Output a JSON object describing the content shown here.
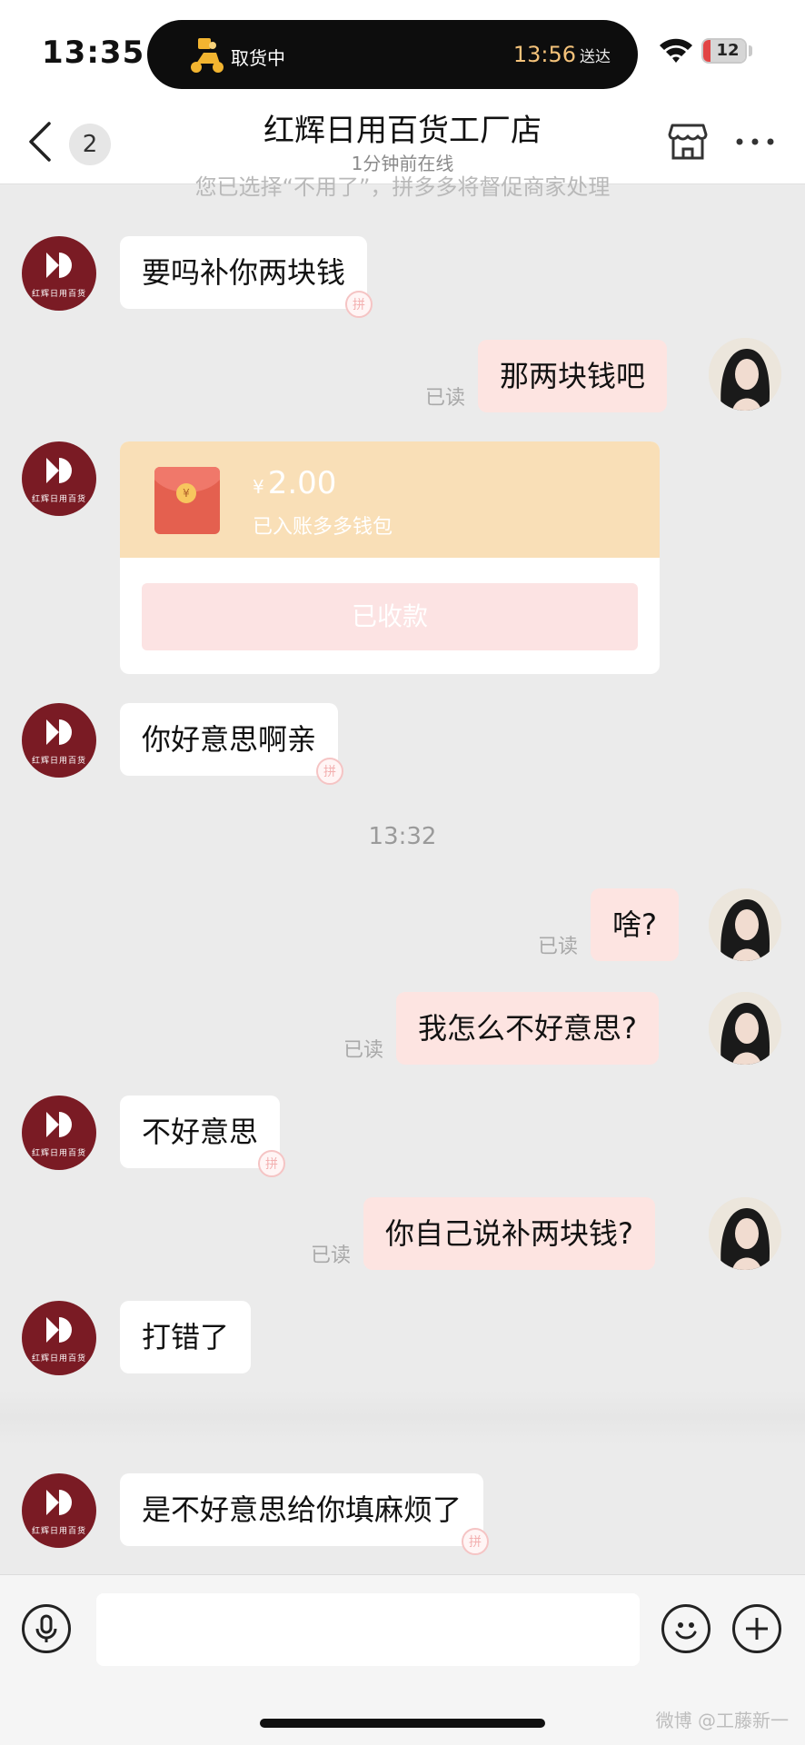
{
  "status_bar": {
    "time": "13:35",
    "delivery_status": "取货中",
    "delivery_eta": "13:56",
    "delivery_eta_suffix": "送达",
    "battery": "12"
  },
  "header": {
    "unread_count": "2",
    "title": "红辉日用百货工厂店",
    "subtitle": "1分钟前在线"
  },
  "chat": {
    "faded_notice": "您已选择“不用了”，拼多多将督促商家处理",
    "shop_avatar_text": "红辉日用百货",
    "read_label": "已读",
    "timestamp": "13:32",
    "messages": [
      {
        "from": "shop",
        "text": "要吗补你两块钱"
      },
      {
        "from": "me",
        "text": "那两块钱吧"
      },
      {
        "from": "shop",
        "type": "red_packet",
        "currency": "¥",
        "amount": "2.00",
        "status_text": "已入账多多钱包",
        "button": "已收款"
      },
      {
        "from": "shop",
        "text": "你好意思啊亲"
      },
      {
        "from": "me",
        "text": "啥?"
      },
      {
        "from": "me",
        "text": "我怎么不好意思?"
      },
      {
        "from": "shop",
        "text": "不好意思"
      },
      {
        "from": "me",
        "text": "你自己说补两块钱?"
      },
      {
        "from": "shop",
        "text": "打错了"
      },
      {
        "from": "shop",
        "text": "是不好意思给你填麻烦了"
      }
    ]
  },
  "icons": {
    "back": "chevron-left-icon",
    "store": "store-icon",
    "more": "more-icon",
    "voice": "microphone-icon",
    "emoji": "emoji-icon",
    "add": "plus-icon"
  },
  "watermark": "微博 @工藤新一",
  "colors": {
    "brand_shop": "#7a1b24",
    "my_bubble": "#fde4e1",
    "packet_top": "#f9dfb7"
  }
}
